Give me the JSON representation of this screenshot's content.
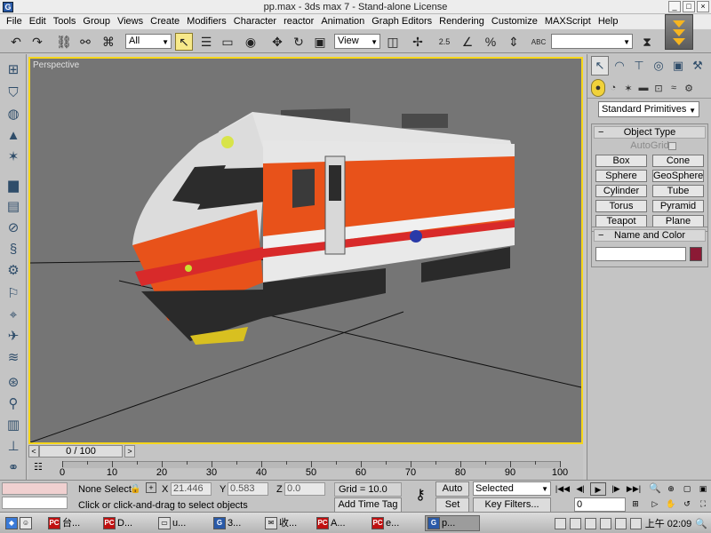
{
  "window": {
    "title": "pp.max - 3ds max 7 - Stand-alone License",
    "app_icon_glyph": "G",
    "min": "_",
    "max": "□",
    "close": "×"
  },
  "menu": [
    "File",
    "Edit",
    "Tools",
    "Group",
    "Views",
    "Create",
    "Modifiers",
    "Character",
    "reactor",
    "Animation",
    "Graph Editors",
    "Rendering",
    "Customize",
    "MAXScript",
    "Help"
  ],
  "toolbar": {
    "selection_filter": "All",
    "reference_coord": "View",
    "spinner_snap_label": "2.5",
    "percent_snap_label": "%",
    "abc_label": "ABC"
  },
  "viewport": {
    "label": "Perspective",
    "border_color": "#f6d61a",
    "background": "#757575"
  },
  "command_panel": {
    "category": "Standard Primitives",
    "object_type_title": "Object Type",
    "autogrid": "AutoGrid",
    "primitives": [
      "Box",
      "Cone",
      "Sphere",
      "GeoSphere",
      "Cylinder",
      "Tube",
      "Torus",
      "Pyramid",
      "Teapot",
      "Plane"
    ],
    "name_color_title": "Name and Color",
    "object_color": "#8b1a35",
    "minus": "−"
  },
  "timeline": {
    "frame_display": "0 / 100",
    "prev": "<",
    "next": ">",
    "ticks": [
      "0",
      "10",
      "20",
      "30",
      "40",
      "50",
      "60",
      "70",
      "80",
      "90",
      "100"
    ]
  },
  "status": {
    "selection": "None Select",
    "x_label": "X",
    "x_value": "21.446",
    "y_label": "Y",
    "y_value": "0.583",
    "z_label": "Z",
    "z_value": "0.0",
    "grid": "Grid = 10.0",
    "prompt": "Click or click-and-drag to select objects",
    "add_time_tag": "Add Time Tag",
    "auto_key": "Auto Key",
    "set_key": "Set Key",
    "key_mode": "Selected",
    "key_filters": "Key Filters...",
    "current_frame": "0"
  },
  "taskbar": {
    "items": [
      "台...",
      "D...",
      "u...",
      "3...",
      "收...",
      "A...",
      "e...",
      "p..."
    ],
    "clock": "上午 02:09"
  }
}
